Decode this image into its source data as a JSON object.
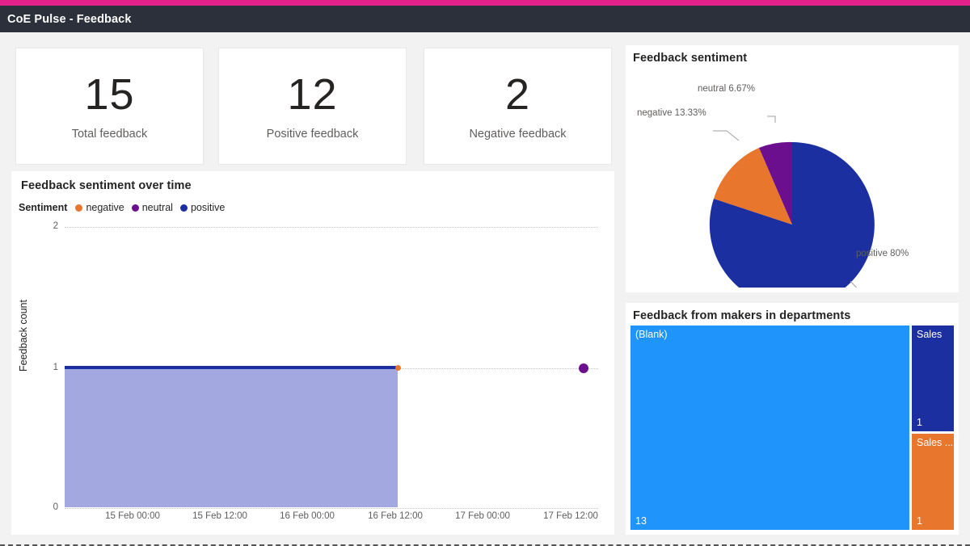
{
  "header": {
    "title": "CoE Pulse - Feedback",
    "accent_color": "#e2218a",
    "bar_color": "#2b303b"
  },
  "kpis": [
    {
      "value": "15",
      "label": "Total feedback"
    },
    {
      "value": "12",
      "label": "Positive feedback"
    },
    {
      "value": "2",
      "label": "Negative feedback"
    }
  ],
  "colors": {
    "negative": "#e8762c",
    "neutral": "#6b0f8f",
    "positive": "#1c2fa0",
    "area_fill": "#a3a9e0",
    "tree_blank": "#1f94fb",
    "tree_sales": "#1c2fa0",
    "tree_sales_other": "#e8762c",
    "panel_bg": "#ffffff",
    "page_bg": "#f2f2f2"
  },
  "line_chart": {
    "title": "Feedback sentiment over time",
    "legend_title": "Sentiment",
    "legend": [
      {
        "label": "negative",
        "color": "#e8762c"
      },
      {
        "label": "neutral",
        "color": "#6b0f8f"
      },
      {
        "label": "positive",
        "color": "#1c2fa0"
      }
    ]
  },
  "pie_chart": {
    "title": "Feedback sentiment"
  },
  "treemap": {
    "title": "Feedback from makers in departments",
    "tiles": [
      {
        "label": "(Blank)",
        "value": "13",
        "color": "#1f94fb"
      },
      {
        "label": "Sales",
        "value": "1",
        "color": "#1c2fa0"
      },
      {
        "label": "Sales ...",
        "value": "1",
        "color": "#e8762c"
      }
    ]
  },
  "chart_data": [
    {
      "type": "area",
      "title": "Feedback sentiment over time",
      "xlabel": "",
      "ylabel": "Feedback count",
      "ylim": [
        0,
        2
      ],
      "yticks": [
        "0",
        "1",
        "2"
      ],
      "xticks": [
        "15 Feb 00:00",
        "15 Feb 12:00",
        "16 Feb 00:00",
        "16 Feb 12:00",
        "17 Feb 00:00",
        "17 Feb 12:00"
      ],
      "grid": true,
      "legend_position": "top-left",
      "series": [
        {
          "name": "negative",
          "color": "#e8762c",
          "points": [
            {
              "x": "16 Feb 12:00",
              "y": 1
            }
          ]
        },
        {
          "name": "neutral",
          "color": "#6b0f8f",
          "points": [
            {
              "x": "17 Feb 12:00",
              "y": 1
            }
          ]
        },
        {
          "name": "positive",
          "color": "#1c2fa0",
          "points": [
            {
              "x": "14 Feb 12:00",
              "y": 1
            },
            {
              "x": "16 Feb 12:00",
              "y": 1
            }
          ]
        }
      ]
    },
    {
      "type": "pie",
      "title": "Feedback sentiment",
      "labels": [
        "positive",
        "negative",
        "neutral"
      ],
      "values": [
        80,
        13.33,
        6.67
      ],
      "value_labels": [
        "positive 80%",
        "negative 13.33%",
        "neutral 6.67%"
      ],
      "colors": [
        "#1c2fa0",
        "#e8762c",
        "#6b0f8f"
      ],
      "legend_position": "none"
    },
    {
      "type": "treemap",
      "title": "Feedback from makers in departments",
      "labels": [
        "(Blank)",
        "Sales",
        "Sales ..."
      ],
      "values": [
        13,
        1,
        1
      ],
      "colors": [
        "#1f94fb",
        "#1c2fa0",
        "#e8762c"
      ]
    }
  ]
}
